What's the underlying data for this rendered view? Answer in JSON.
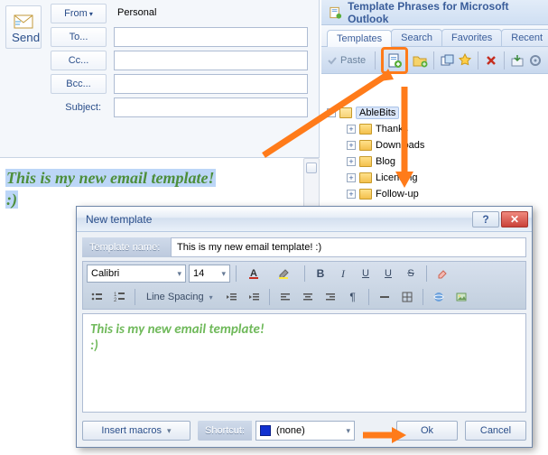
{
  "compose": {
    "send_label": "Send",
    "from_label": "From",
    "account_label": "Personal",
    "to_label": "To...",
    "cc_label": "Cc...",
    "bcc_label": "Bcc...",
    "subject_label": "Subject:",
    "body_line1": "This is my new email template!",
    "body_line2": ":)"
  },
  "template_pane": {
    "title": "Template Phrases for Microsoft Outlook",
    "tabs": [
      "Templates",
      "Search",
      "Favorites",
      "Recent"
    ],
    "active_tab": "Templates",
    "toolbar": {
      "paste_label": "Paste"
    },
    "tree": {
      "root": "AbleBits",
      "children": [
        "Thanks",
        "Downloads",
        "Blog",
        "Licensing",
        "Follow-up"
      ]
    }
  },
  "dialog": {
    "title": "New template",
    "name_label": "Template name:",
    "name_value": "This is my new email template! :)",
    "font_name": "Calibri",
    "font_size": "14",
    "linespacing_label": "Line Spacing",
    "editor_line1": "This is my new email template!",
    "editor_line2": ":)",
    "insert_macros_label": "Insert macros",
    "shortcut_label": "Shortcut:",
    "shortcut_value": "(none)",
    "ok_label": "Ok",
    "cancel_label": "Cancel"
  },
  "colors": {
    "accent_orange": "#ff7b1a",
    "selection_blue": "#bcd6f7",
    "green_text": "#6fb95a"
  }
}
